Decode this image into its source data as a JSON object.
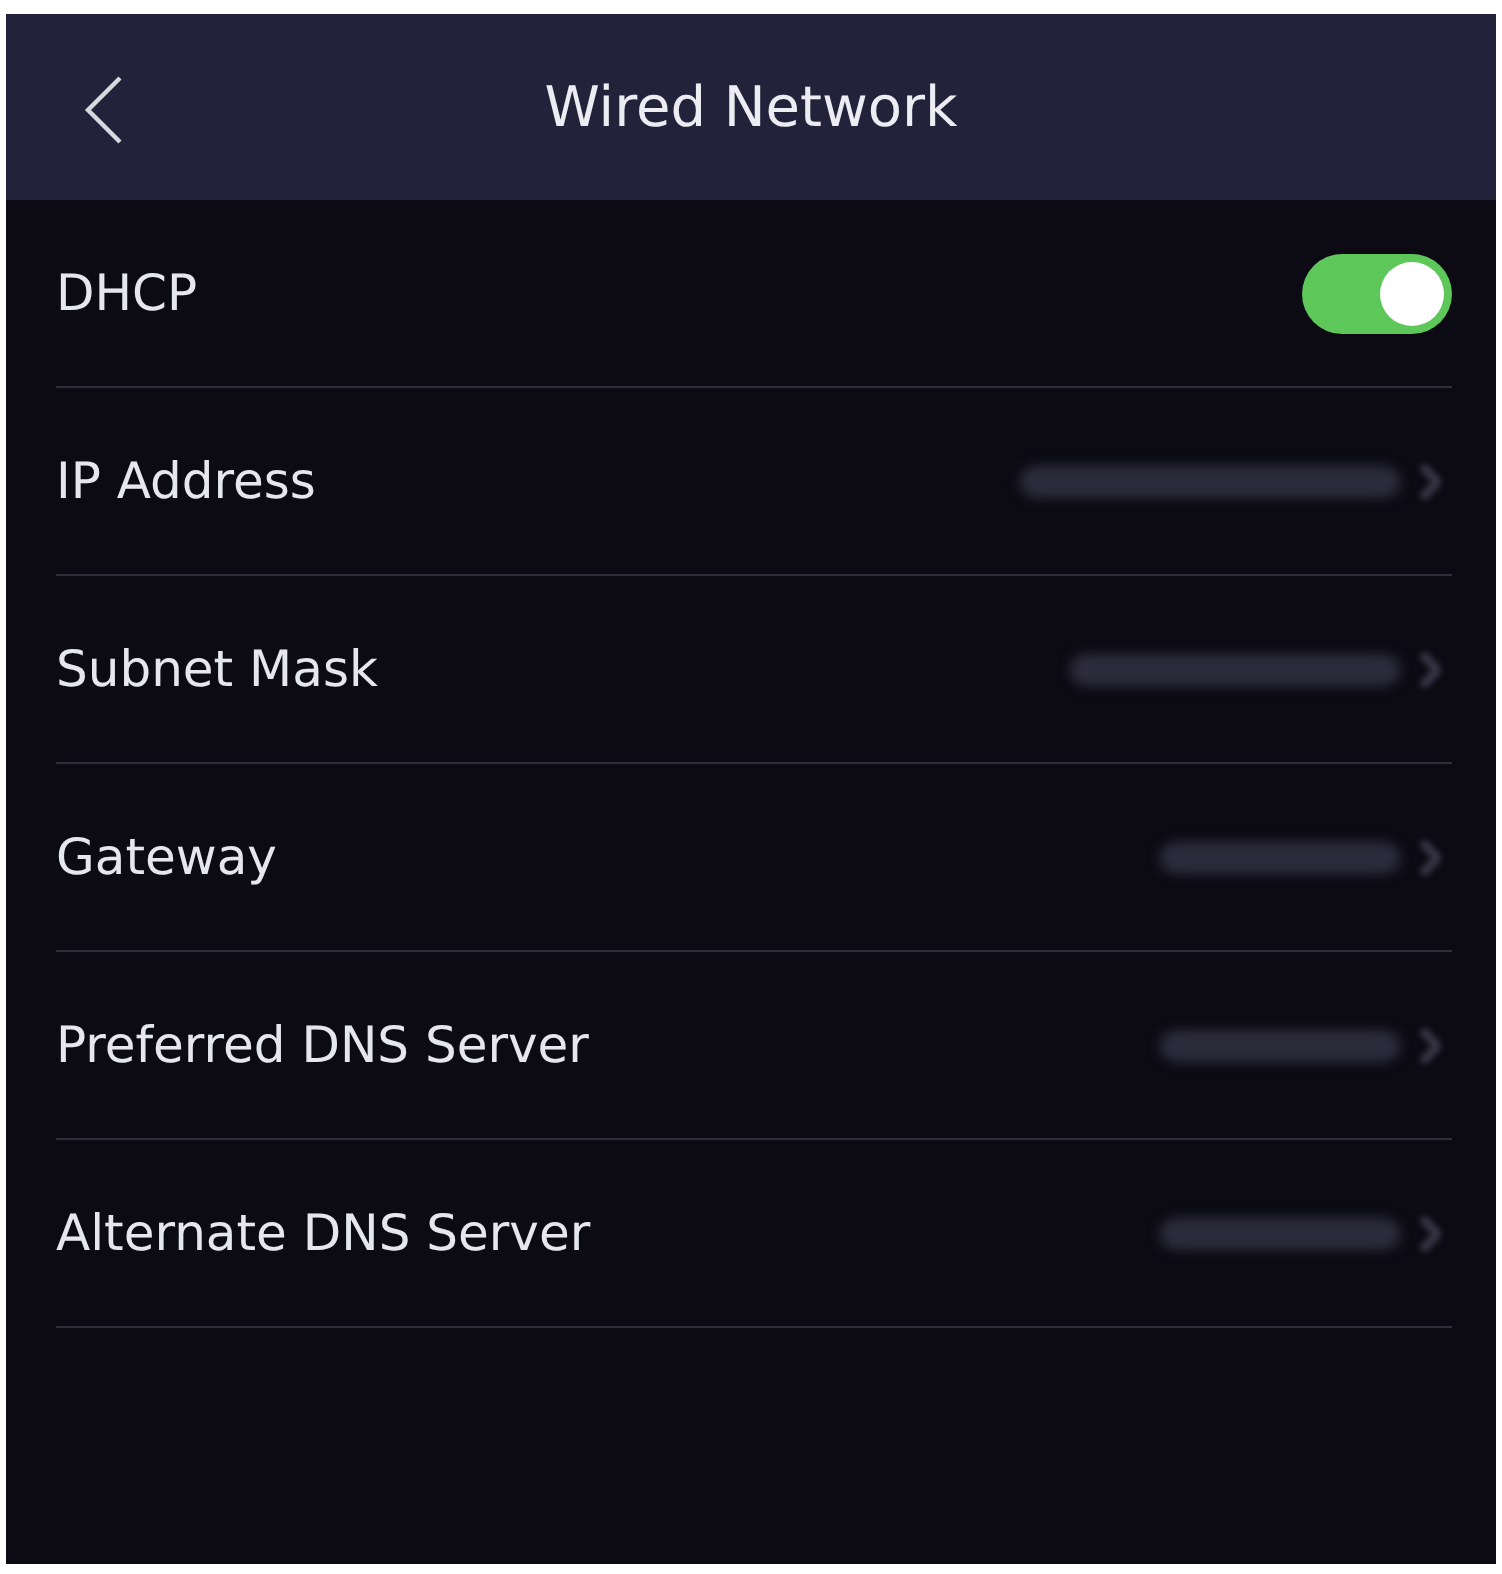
{
  "header": {
    "title": "Wired Network"
  },
  "rows": [
    {
      "kind": "toggle",
      "label": "DHCP",
      "on": true
    },
    {
      "kind": "link",
      "label": "IP Address"
    },
    {
      "kind": "link",
      "label": "Subnet Mask"
    },
    {
      "kind": "link",
      "label": "Gateway"
    },
    {
      "kind": "link",
      "label": "Preferred DNS Server"
    },
    {
      "kind": "link",
      "label": "Alternate DNS Server"
    }
  ]
}
